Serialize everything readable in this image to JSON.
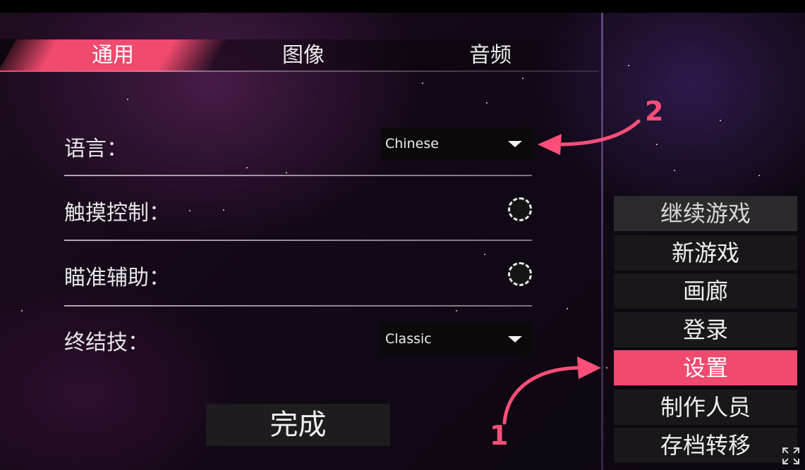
{
  "tabs": [
    {
      "label": "通用",
      "active": true
    },
    {
      "label": "图像",
      "active": false
    },
    {
      "label": "音频",
      "active": false
    }
  ],
  "settings": {
    "language": {
      "label": "语言：",
      "value": "Chinese"
    },
    "touch_control": {
      "label": "触摸控制：",
      "enabled": false
    },
    "aim_assist": {
      "label": "瞄准辅助：",
      "enabled": false
    },
    "finisher": {
      "label": "终结技：",
      "value": "Classic"
    }
  },
  "done_label": "完成",
  "menu": [
    {
      "label": "继续游戏"
    },
    {
      "label": "新游戏"
    },
    {
      "label": "画廊"
    },
    {
      "label": "登录"
    },
    {
      "label": "设置",
      "active": true
    },
    {
      "label": "制作人员"
    },
    {
      "label": "存档转移"
    }
  ],
  "annotations": {
    "one": "1",
    "two": "2"
  },
  "colors": {
    "accent": "#f04a6e",
    "annotation": "#ff4f78"
  },
  "icons": {
    "dropdown": "caret-down-icon",
    "fullscreen": "fullscreen-icon"
  }
}
